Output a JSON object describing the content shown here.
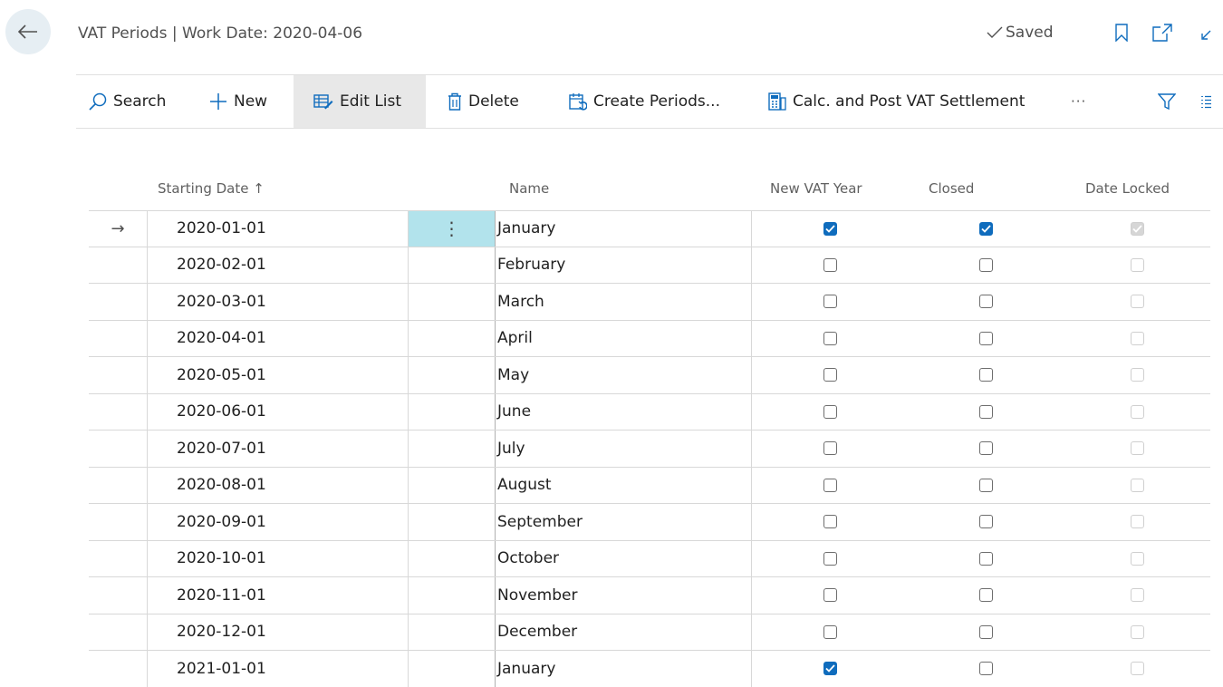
{
  "header": {
    "title": "VAT Periods | Work Date: 2020-04-06",
    "saved_label": "Saved"
  },
  "actions": {
    "search": "Search",
    "new": "New",
    "edit_list": "Edit List",
    "delete": "Delete",
    "create_periods": "Create Periods...",
    "calc_post": "Calc. and Post VAT Settlement",
    "more": "···"
  },
  "columns": {
    "starting_date": "Starting Date ↑",
    "name": "Name",
    "new_vat_year": "New VAT Year",
    "closed": "Closed",
    "date_locked": "Date Locked"
  },
  "rows": [
    {
      "date": "2020-01-01",
      "name": "January",
      "new_vat_year": true,
      "closed": true,
      "date_locked": true
    },
    {
      "date": "2020-02-01",
      "name": "February",
      "new_vat_year": false,
      "closed": false,
      "date_locked": false
    },
    {
      "date": "2020-03-01",
      "name": "March",
      "new_vat_year": false,
      "closed": false,
      "date_locked": false
    },
    {
      "date": "2020-04-01",
      "name": "April",
      "new_vat_year": false,
      "closed": false,
      "date_locked": false
    },
    {
      "date": "2020-05-01",
      "name": "May",
      "new_vat_year": false,
      "closed": false,
      "date_locked": false
    },
    {
      "date": "2020-06-01",
      "name": "June",
      "new_vat_year": false,
      "closed": false,
      "date_locked": false
    },
    {
      "date": "2020-07-01",
      "name": "July",
      "new_vat_year": false,
      "closed": false,
      "date_locked": false
    },
    {
      "date": "2020-08-01",
      "name": "August",
      "new_vat_year": false,
      "closed": false,
      "date_locked": false
    },
    {
      "date": "2020-09-01",
      "name": "September",
      "new_vat_year": false,
      "closed": false,
      "date_locked": false
    },
    {
      "date": "2020-10-01",
      "name": "October",
      "new_vat_year": false,
      "closed": false,
      "date_locked": false
    },
    {
      "date": "2020-11-01",
      "name": "November",
      "new_vat_year": false,
      "closed": false,
      "date_locked": false
    },
    {
      "date": "2020-12-01",
      "name": "December",
      "new_vat_year": false,
      "closed": false,
      "date_locked": false
    },
    {
      "date": "2021-01-01",
      "name": "January",
      "new_vat_year": true,
      "closed": false,
      "date_locked": false
    }
  ],
  "selected_row": 0,
  "row_menu_glyph": "⋮",
  "current_row_arrow": "→",
  "colors": {
    "accent": "#0f6cbd",
    "selected_cell": "#b2e3ec",
    "active_action": "#e8e8e8"
  },
  "icons": {
    "back": "back-arrow-icon",
    "saved": "checkmark-icon",
    "bookmark": "bookmark-icon",
    "open_new": "open-in-new-window-icon",
    "collapse": "collapse-icon",
    "search": "search-icon",
    "new": "plus-icon",
    "edit_list": "edit-list-icon",
    "delete": "trash-icon",
    "create_periods": "create-periods-icon",
    "calc_post": "calculator-icon",
    "filter": "filter-icon",
    "list_view": "list-view-icon"
  }
}
